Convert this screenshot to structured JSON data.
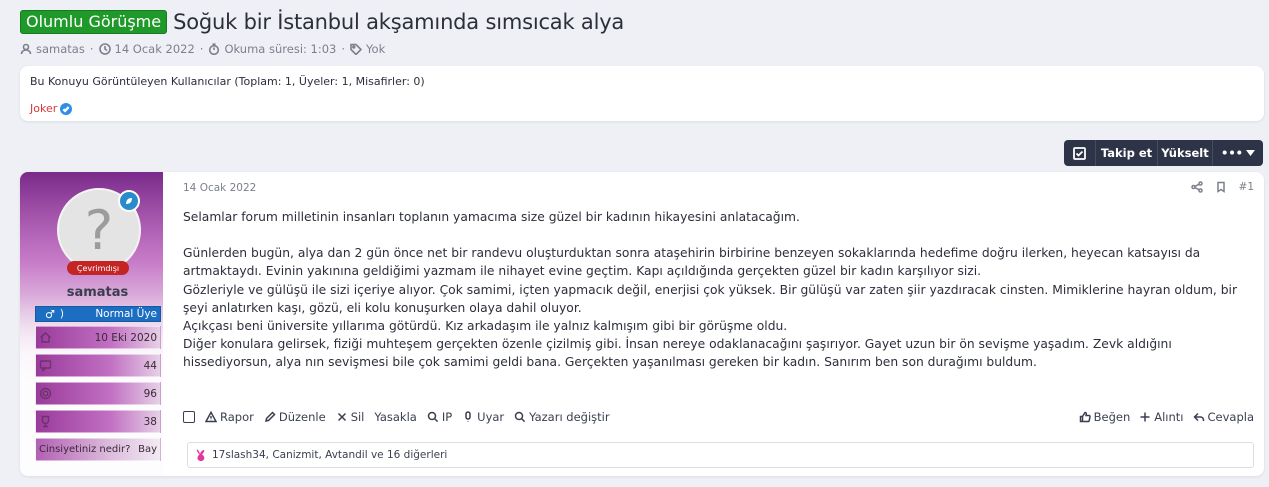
{
  "thread": {
    "prefix": "Olumlu Görüşme",
    "title": "Soğuk bir İstanbul akşamında sımsıcak alya",
    "meta": {
      "author": "samatas",
      "date": "14 Ocak 2022",
      "reading_time": "Okuma süresi: 1:03",
      "tags": "Yok"
    }
  },
  "viewers": {
    "title": "Bu Konuyu Görüntüleyen Kullanıcılar (Toplam: 1, Üyeler: 1, Misafirler: 0)",
    "users": [
      "Joker"
    ]
  },
  "toolbar": {
    "follow": "Takip et",
    "boost": "Yükselt",
    "more": "•••"
  },
  "post": {
    "date": "14 Ocak 2022",
    "number": "#1",
    "author": {
      "username": "samatas",
      "status": "Çevrimdışı",
      "gender_symbol": "♂",
      "rank": "Normal Üye",
      "avatar_glyph": "?",
      "stats": [
        {
          "icon": "home-icon",
          "value": "10 Eki 2020"
        },
        {
          "icon": "message-icon",
          "value": "44"
        },
        {
          "icon": "target-icon",
          "value": "96"
        },
        {
          "icon": "trophy-icon",
          "value": "38"
        }
      ],
      "orientation_label": "Cinsiyetiniz nedir?",
      "orientation_value": "Bay"
    },
    "paragraphs": [
      "Selamlar forum milletinin insanları toplanın yamacıma size güzel bir kadının hikayesini anlatacağım.",
      "Günlerden bugün, alya dan 2 gün önce net bir randevu oluşturduktan sonra ataşehirin birbirine benzeyen sokaklarında hedefime doğru ilerken, heyecan katsayısı da artmaktaydı. Evinin yakınına geldiğimi yazmam ile nihayet evine geçtim. Kapı açıldığında gerçekten güzel bir kadın karşılıyor sizi.",
      "Gözleriyle ve gülüşü ile sizi içeriye alıyor. Çok samimi, içten yapmacık değil, enerjisi çok yüksek. Bir gülüşü var zaten şiir yazdıracak cinsten. Mimiklerine hayran oldum, bir şeyi anlatırken kaşı, gözü, eli kolu konuşurken olaya dahil oluyor.",
      "Açıkçası beni üniversite yıllarıma götürdü. Kız arkadaşım ile yalnız kalmışım gibi bir görüşme oldu.",
      "Diğer konulara gelirsek, fiziği muhteşem gerçekten özenle çizilmiş gibi. İnsan nereye odaklanacağını şaşırıyor. Gayet uzun bir ön sevişme yaşadım. Zevk aldığını hissediyorsun, alya nın sevişmesi bile çok samimi geldi bana. Gerçekten yaşanılması gereken bir kadın. Sanırım ben son durağımı buldum."
    ],
    "actions_left": {
      "report": "Rapor",
      "edit": "Düzenle",
      "delete": "Sil",
      "ban": "Yasakla",
      "ip": "IP",
      "warn": "Uyar",
      "change_author": "Yazarı değiştir"
    },
    "actions_right": {
      "like": "Beğen",
      "quote": "Alıntı",
      "reply": "Cevapla"
    },
    "reactions_text": "17slash34, Canizmit, Avtandil ve 16 diğerleri"
  },
  "colors": {
    "prefix_green": "#1f9a2a",
    "toolbar_bg": "#2e3447",
    "rank_blue": "#1b6ec2",
    "status_red": "#c42424",
    "viewer_red": "#d63737",
    "profile_purple": "#9a3b9b"
  }
}
